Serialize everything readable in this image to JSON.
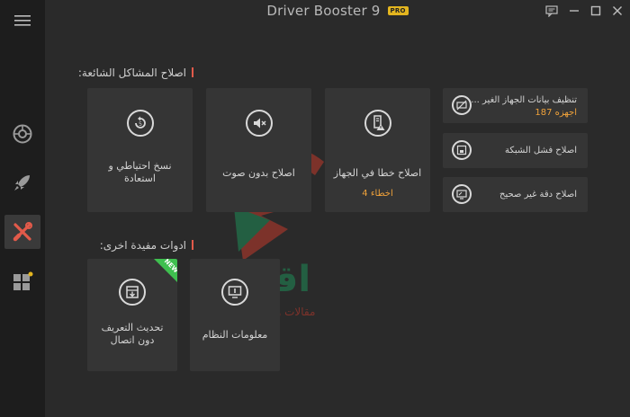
{
  "window": {
    "title": "Driver Booster 9",
    "badge": "PRO"
  },
  "sidebar": {
    "items": [
      {
        "icon": "hamburger-menu-icon"
      },
      {
        "icon": "scan-dial-icon"
      },
      {
        "icon": "rocket-icon"
      },
      {
        "icon": "tools-icon",
        "active": true
      },
      {
        "icon": "apps-grid-icon"
      }
    ]
  },
  "common_fixes": {
    "title": "اصلاح المشاكل الشائعة:",
    "cards": [
      {
        "label": "نسخ احتياطي و استعادة",
        "icon": "backup-restore-icon"
      },
      {
        "label": "اصلاح بدون صوت",
        "icon": "no-sound-icon"
      },
      {
        "label": "اصلاح خطا في الجهاز",
        "sub": "اخطاء 4",
        "icon": "device-error-icon"
      }
    ],
    "rows": [
      {
        "label": "تنظيف بيانات الجهاز الغير ...",
        "sub": "اجهزه 187",
        "icon": "clean-device-icon"
      },
      {
        "label": "اصلاح فشل الشبكة",
        "icon": "network-fix-icon"
      },
      {
        "label": "اصلاح دقة غير صحيح",
        "icon": "resolution-fix-icon"
      }
    ]
  },
  "other_tools": {
    "title": "ادوات مفيدة اخرى:",
    "cards": [
      {
        "label": "تحديث التعريف دون اتصال",
        "badge": "NEW",
        "icon": "offline-update-icon"
      },
      {
        "label": "معلومات النظام",
        "icon": "system-info-icon"
      }
    ]
  },
  "watermark": {
    "text": "اقتني",
    "subtext": "مقالات وفيديوهات"
  },
  "colors": {
    "accent_red": "#e25a4a",
    "warning_orange": "#f0a23a",
    "new_green": "#3fbf4f",
    "pro_yellow": "#e3b51f"
  }
}
